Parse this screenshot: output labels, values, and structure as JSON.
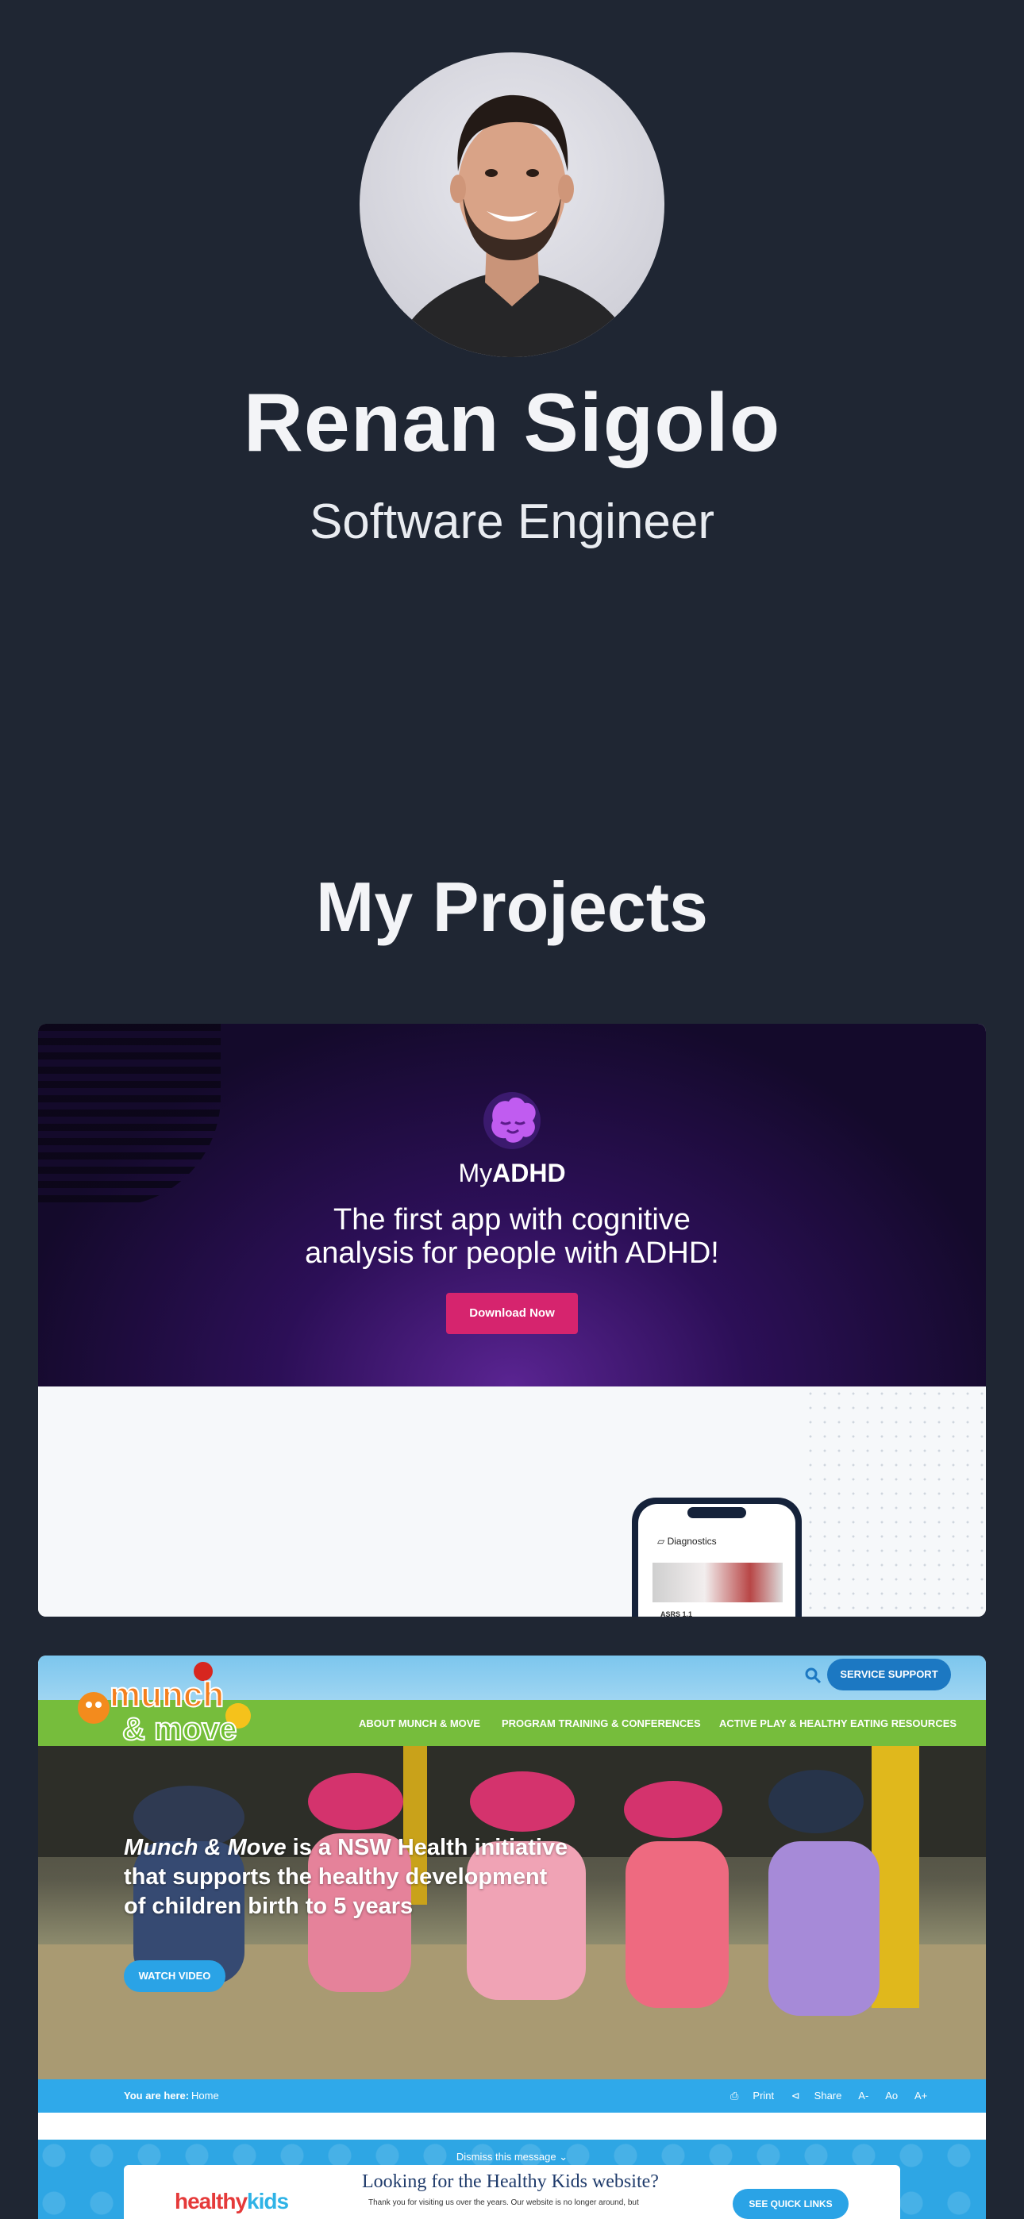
{
  "profile": {
    "name": "Renan Sigolo",
    "role": "Software Engineer"
  },
  "projects": {
    "title": "My Projects",
    "items": [
      {
        "brand_prefix": "My",
        "brand_suffix": "ADHD",
        "tagline": "The first app with cognitive analysis for people with ADHD!",
        "button": "Download Now",
        "phone_screen_title": "Diagnostics",
        "phone_screen_item": "ASRS 1.1"
      },
      {
        "logo_line1": "munch",
        "logo_line2": "& move",
        "service_button": "SERVICE SUPPORT",
        "nav": [
          "ABOUT MUNCH & MOVE",
          "PROGRAM TRAINING & CONFERENCES",
          "ACTIVE PLAY & HEALTHY EATING RESOURCES"
        ],
        "headline_em": "Munch & Move",
        "headline_rest": " is a NSW Health initiative that supports the healthy development of children birth to 5 years",
        "watch_button": "WATCH VIDEO",
        "breadcrumb_label": "You are here:",
        "breadcrumb_home": "Home",
        "tools": [
          "Print",
          "Share",
          "A-",
          "Ao",
          "A+"
        ],
        "dismiss": "Dismiss this message",
        "hk_logo_a": "healthy",
        "hk_logo_b": "kids",
        "hk_title": "Looking for the Healthy Kids website?",
        "hk_sub": "Thank you for visiting us over the years. Our website is no longer around, but",
        "hk_button": "SEE QUICK LINKS"
      }
    ]
  },
  "colors": {
    "background": "#1f2633",
    "adhd_button": "#d6246e",
    "munch_blue": "#2fa9ea"
  }
}
